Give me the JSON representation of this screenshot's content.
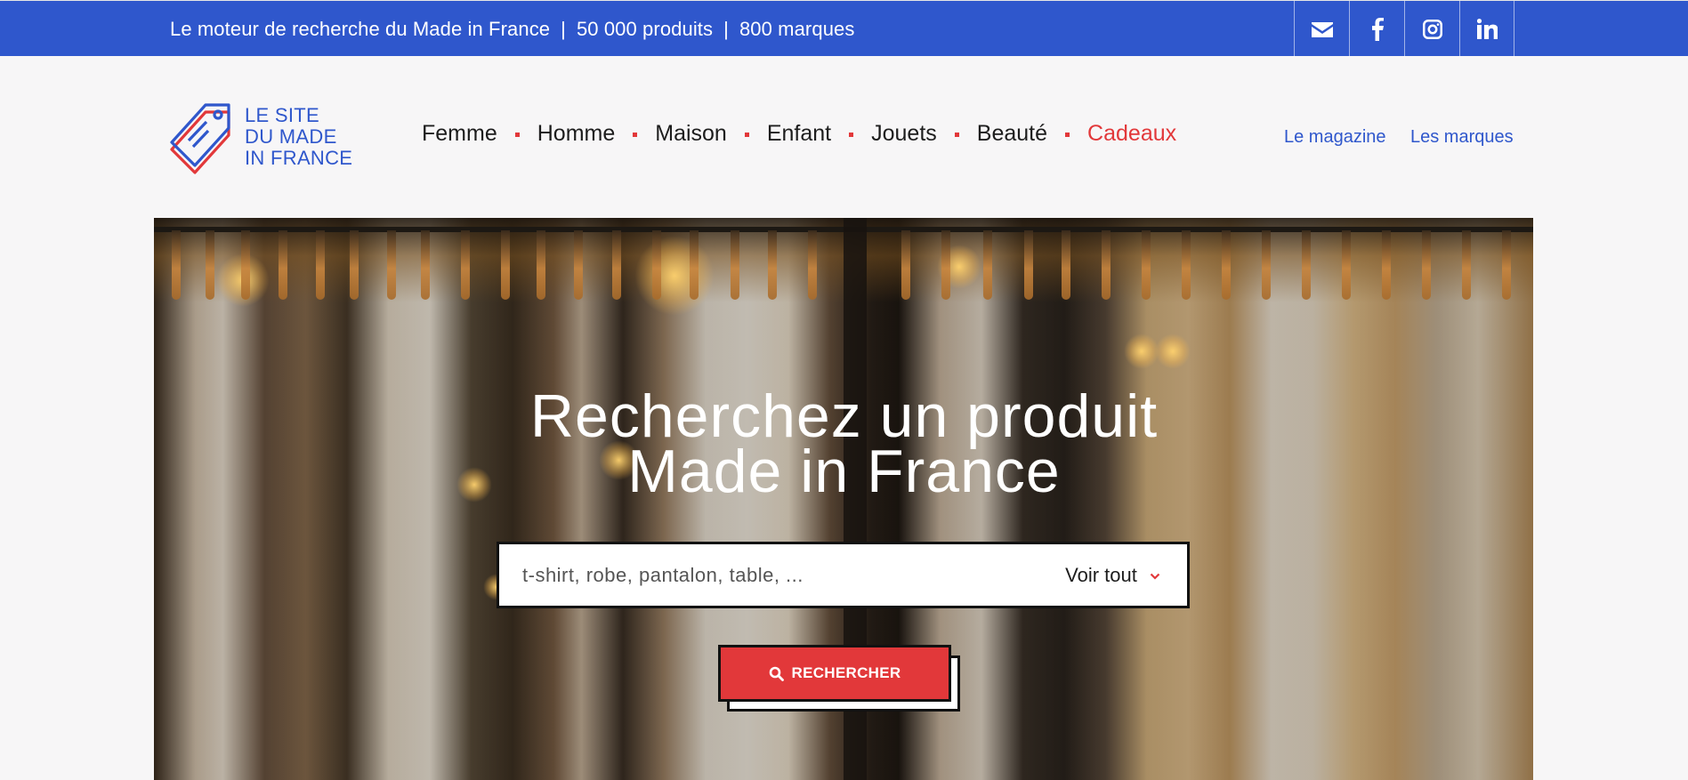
{
  "topbar": {
    "tagline": "Le moteur de recherche du Made in France",
    "sep1": "|",
    "products": "50 000 produits",
    "sep2": "|",
    "brands": "800 marques",
    "socials": [
      "envelope-icon",
      "facebook-icon",
      "instagram-icon",
      "linkedin-icon"
    ],
    "background": "#2f57cc"
  },
  "logo": {
    "line1": "LE SITE",
    "line2": "DU MADE",
    "line3": "IN FRANCE",
    "color": "#2f57cc",
    "accent": "#e2383a"
  },
  "nav": {
    "items": [
      {
        "label": "Femme"
      },
      {
        "label": "Homme"
      },
      {
        "label": "Maison"
      },
      {
        "label": "Enfant"
      },
      {
        "label": "Jouets"
      },
      {
        "label": "Beauté"
      },
      {
        "label": "Cadeaux"
      }
    ],
    "magazine": "Le magazine",
    "brands": "Les marques"
  },
  "hero": {
    "title_line1": "Recherchez un produit",
    "title_line2": "Made in France",
    "search_placeholder": "t-shirt, robe, pantalon, table, ...",
    "category_select": "Voir tout",
    "search_button": "RECHERCHER"
  }
}
